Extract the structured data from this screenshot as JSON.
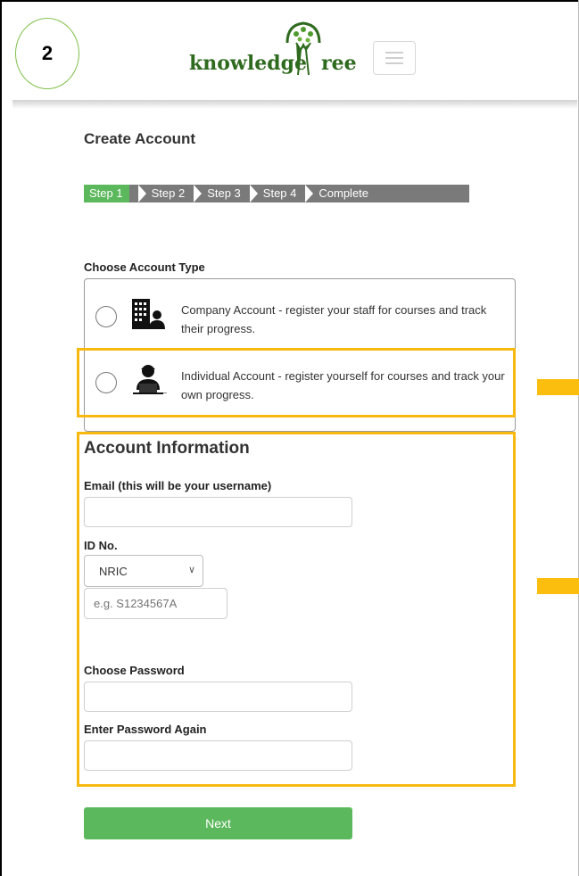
{
  "annotation": {
    "step_number": "2",
    "highlight_color": "#f7b80f"
  },
  "header": {
    "logo_text": "knowledge",
    "logo_text_end": "ree",
    "brand_color": "#2f6b1f"
  },
  "page": {
    "title": "Create Account"
  },
  "stepper": {
    "steps": [
      "Step 1",
      "Step 2",
      "Step 3",
      "Step 4",
      "Complete"
    ],
    "active_index": 0,
    "active_color": "#5cb85c",
    "inactive_color": "#7a7a7a"
  },
  "account_type": {
    "label": "Choose Account Type",
    "options": [
      {
        "icon": "office-building-icon",
        "text": "Company Account - register your staff for courses and track their progress."
      },
      {
        "icon": "individual-user-icon",
        "text": "Individual Account - register yourself for courses and track your own progress."
      }
    ]
  },
  "account_info": {
    "title": "Account Information",
    "email_label": "Email (this will be your username)",
    "email_value": "",
    "id_label": "ID No.",
    "id_type_selected": "NRIC",
    "id_placeholder": "e.g. S1234567A",
    "password_label": "Choose Password",
    "password_again_label": "Enter Password Again"
  },
  "actions": {
    "next_label": "Next",
    "next_color": "#5cb85c"
  }
}
